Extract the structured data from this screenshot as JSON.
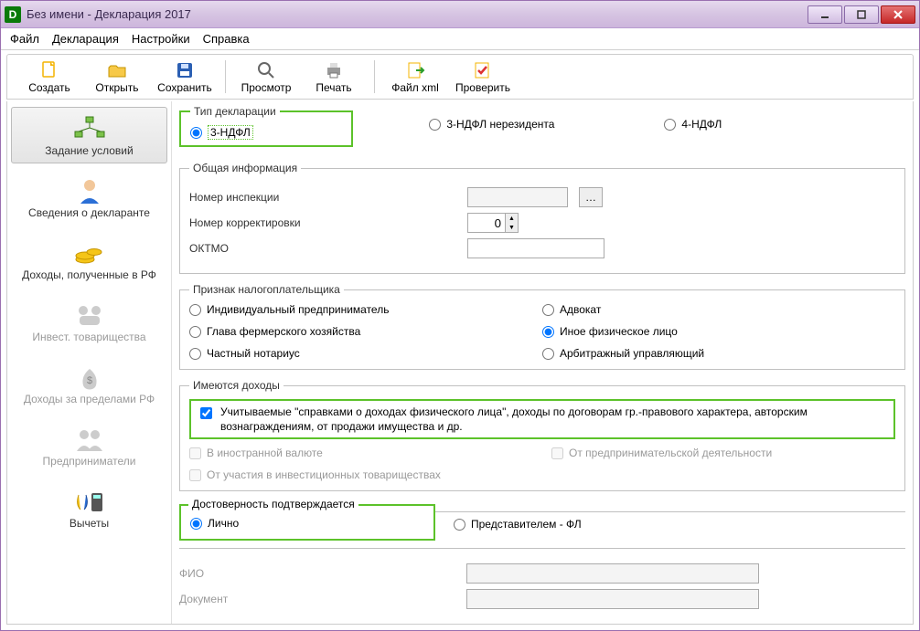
{
  "window": {
    "title": "Без имени - Декларация 2017"
  },
  "menu": {
    "file": "Файл",
    "declaration": "Декларация",
    "settings": "Настройки",
    "help": "Справка"
  },
  "toolbar": {
    "create": "Создать",
    "open": "Открыть",
    "save": "Сохранить",
    "view": "Просмотр",
    "print": "Печать",
    "xml": "Файл xml",
    "check": "Проверить"
  },
  "sidebar": {
    "items": [
      {
        "label": "Задание условий"
      },
      {
        "label": "Сведения о декларанте"
      },
      {
        "label": "Доходы, полученные в РФ"
      },
      {
        "label": "Инвест. товарищества"
      },
      {
        "label": "Доходы за пределами РФ"
      },
      {
        "label": "Предприниматели"
      },
      {
        "label": "Вычеты"
      }
    ]
  },
  "decl_type": {
    "legend": "Тип декларации",
    "ndfl3": "3-НДФЛ",
    "ndfl3_nr": "3-НДФЛ нерезидента",
    "ndfl4": "4-НДФЛ"
  },
  "general": {
    "legend": "Общая информация",
    "insp": "Номер инспекции",
    "corr": "Номер корректировки",
    "corr_val": "0",
    "oktmo": "ОКТМО"
  },
  "taxpayer": {
    "legend": "Признак налогоплательщика",
    "ip": "Индивидуальный предприниматель",
    "advocate": "Адвокат",
    "farmer": "Глава фермерского хозяйства",
    "other_phys": "Иное физическое лицо",
    "notary": "Частный нотариус",
    "arbitr": "Арбитражный управляющий"
  },
  "income": {
    "legend": "Имеются доходы",
    "main_chk": "Учитываемые \"справками о доходах физического лица\", доходы по договорам гр.-правового характера, авторским вознаграждениям, от продажи имущества и др.",
    "foreign": "В иностранной валюте",
    "entrepreneur": "От предпринимательской деятельности",
    "invest": "От участия в инвестиционных товариществах"
  },
  "credibility": {
    "legend": "Достоверность подтверждается",
    "personal": "Лично",
    "repr": "Представителем - ФЛ",
    "fio": "ФИО",
    "doc": "Документ"
  }
}
